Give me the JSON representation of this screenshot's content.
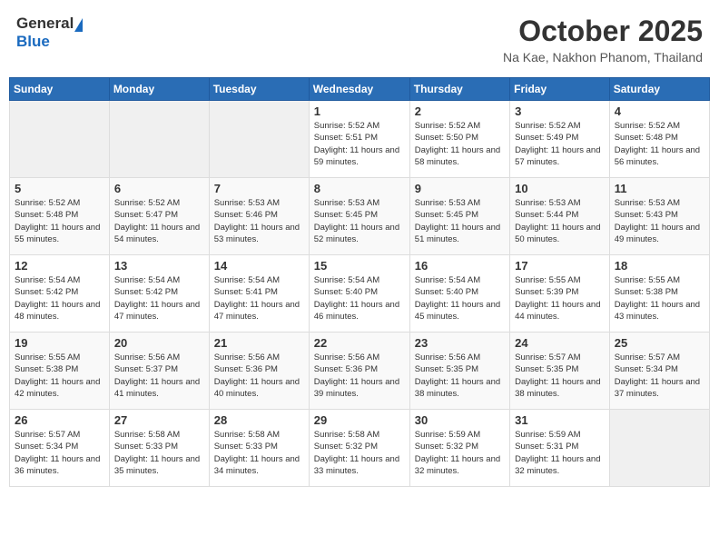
{
  "header": {
    "logo_general": "General",
    "logo_blue": "Blue",
    "month": "October 2025",
    "location": "Na Kae, Nakhon Phanom, Thailand"
  },
  "weekdays": [
    "Sunday",
    "Monday",
    "Tuesday",
    "Wednesday",
    "Thursday",
    "Friday",
    "Saturday"
  ],
  "weeks": [
    [
      {
        "day": "",
        "info": ""
      },
      {
        "day": "",
        "info": ""
      },
      {
        "day": "",
        "info": ""
      },
      {
        "day": "1",
        "info": "Sunrise: 5:52 AM\nSunset: 5:51 PM\nDaylight: 11 hours\nand 59 minutes."
      },
      {
        "day": "2",
        "info": "Sunrise: 5:52 AM\nSunset: 5:50 PM\nDaylight: 11 hours\nand 58 minutes."
      },
      {
        "day": "3",
        "info": "Sunrise: 5:52 AM\nSunset: 5:49 PM\nDaylight: 11 hours\nand 57 minutes."
      },
      {
        "day": "4",
        "info": "Sunrise: 5:52 AM\nSunset: 5:48 PM\nDaylight: 11 hours\nand 56 minutes."
      }
    ],
    [
      {
        "day": "5",
        "info": "Sunrise: 5:52 AM\nSunset: 5:48 PM\nDaylight: 11 hours\nand 55 minutes."
      },
      {
        "day": "6",
        "info": "Sunrise: 5:52 AM\nSunset: 5:47 PM\nDaylight: 11 hours\nand 54 minutes."
      },
      {
        "day": "7",
        "info": "Sunrise: 5:53 AM\nSunset: 5:46 PM\nDaylight: 11 hours\nand 53 minutes."
      },
      {
        "day": "8",
        "info": "Sunrise: 5:53 AM\nSunset: 5:45 PM\nDaylight: 11 hours\nand 52 minutes."
      },
      {
        "day": "9",
        "info": "Sunrise: 5:53 AM\nSunset: 5:45 PM\nDaylight: 11 hours\nand 51 minutes."
      },
      {
        "day": "10",
        "info": "Sunrise: 5:53 AM\nSunset: 5:44 PM\nDaylight: 11 hours\nand 50 minutes."
      },
      {
        "day": "11",
        "info": "Sunrise: 5:53 AM\nSunset: 5:43 PM\nDaylight: 11 hours\nand 49 minutes."
      }
    ],
    [
      {
        "day": "12",
        "info": "Sunrise: 5:54 AM\nSunset: 5:42 PM\nDaylight: 11 hours\nand 48 minutes."
      },
      {
        "day": "13",
        "info": "Sunrise: 5:54 AM\nSunset: 5:42 PM\nDaylight: 11 hours\nand 47 minutes."
      },
      {
        "day": "14",
        "info": "Sunrise: 5:54 AM\nSunset: 5:41 PM\nDaylight: 11 hours\nand 47 minutes."
      },
      {
        "day": "15",
        "info": "Sunrise: 5:54 AM\nSunset: 5:40 PM\nDaylight: 11 hours\nand 46 minutes."
      },
      {
        "day": "16",
        "info": "Sunrise: 5:54 AM\nSunset: 5:40 PM\nDaylight: 11 hours\nand 45 minutes."
      },
      {
        "day": "17",
        "info": "Sunrise: 5:55 AM\nSunset: 5:39 PM\nDaylight: 11 hours\nand 44 minutes."
      },
      {
        "day": "18",
        "info": "Sunrise: 5:55 AM\nSunset: 5:38 PM\nDaylight: 11 hours\nand 43 minutes."
      }
    ],
    [
      {
        "day": "19",
        "info": "Sunrise: 5:55 AM\nSunset: 5:38 PM\nDaylight: 11 hours\nand 42 minutes."
      },
      {
        "day": "20",
        "info": "Sunrise: 5:56 AM\nSunset: 5:37 PM\nDaylight: 11 hours\nand 41 minutes."
      },
      {
        "day": "21",
        "info": "Sunrise: 5:56 AM\nSunset: 5:36 PM\nDaylight: 11 hours\nand 40 minutes."
      },
      {
        "day": "22",
        "info": "Sunrise: 5:56 AM\nSunset: 5:36 PM\nDaylight: 11 hours\nand 39 minutes."
      },
      {
        "day": "23",
        "info": "Sunrise: 5:56 AM\nSunset: 5:35 PM\nDaylight: 11 hours\nand 38 minutes."
      },
      {
        "day": "24",
        "info": "Sunrise: 5:57 AM\nSunset: 5:35 PM\nDaylight: 11 hours\nand 38 minutes."
      },
      {
        "day": "25",
        "info": "Sunrise: 5:57 AM\nSunset: 5:34 PM\nDaylight: 11 hours\nand 37 minutes."
      }
    ],
    [
      {
        "day": "26",
        "info": "Sunrise: 5:57 AM\nSunset: 5:34 PM\nDaylight: 11 hours\nand 36 minutes."
      },
      {
        "day": "27",
        "info": "Sunrise: 5:58 AM\nSunset: 5:33 PM\nDaylight: 11 hours\nand 35 minutes."
      },
      {
        "day": "28",
        "info": "Sunrise: 5:58 AM\nSunset: 5:33 PM\nDaylight: 11 hours\nand 34 minutes."
      },
      {
        "day": "29",
        "info": "Sunrise: 5:58 AM\nSunset: 5:32 PM\nDaylight: 11 hours\nand 33 minutes."
      },
      {
        "day": "30",
        "info": "Sunrise: 5:59 AM\nSunset: 5:32 PM\nDaylight: 11 hours\nand 32 minutes."
      },
      {
        "day": "31",
        "info": "Sunrise: 5:59 AM\nSunset: 5:31 PM\nDaylight: 11 hours\nand 32 minutes."
      },
      {
        "day": "",
        "info": ""
      }
    ]
  ]
}
